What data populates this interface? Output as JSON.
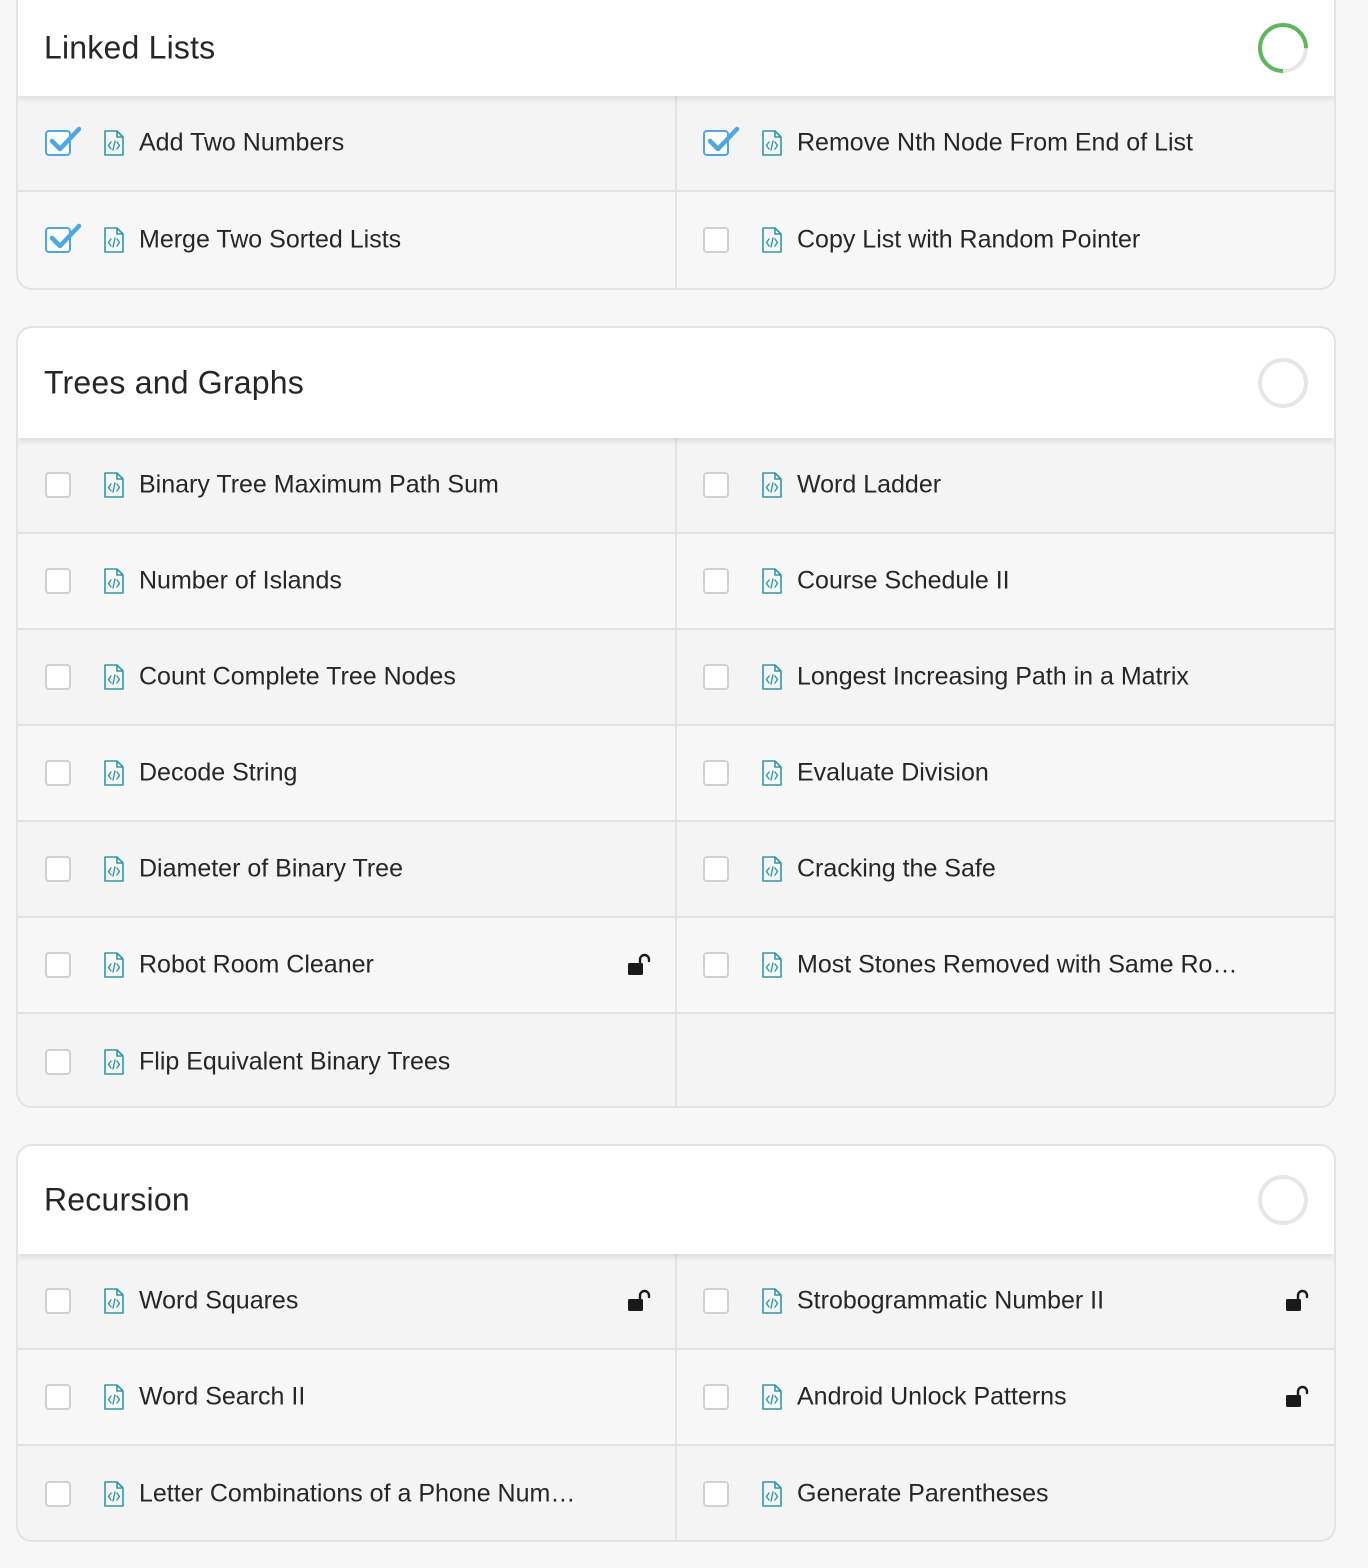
{
  "colors": {
    "accent_blue": "#4aa7e8",
    "progress_green": "#5cb85c",
    "ring_gray": "#e6e6e6",
    "icon_teal": "#2e9aa3",
    "text": "#262626"
  },
  "sections": [
    {
      "title": "Linked Lists",
      "progress": 0.75,
      "items": [
        {
          "label": "Add Two Numbers",
          "checked": true,
          "locked": false
        },
        {
          "label": "Remove Nth Node From End of List",
          "checked": true,
          "locked": false
        },
        {
          "label": "Merge Two Sorted Lists",
          "checked": true,
          "locked": false
        },
        {
          "label": "Copy List with Random Pointer",
          "checked": false,
          "locked": false
        }
      ]
    },
    {
      "title": "Trees and Graphs",
      "progress": 0,
      "items": [
        {
          "label": "Binary Tree Maximum Path Sum",
          "checked": false,
          "locked": false
        },
        {
          "label": "Word Ladder",
          "checked": false,
          "locked": false
        },
        {
          "label": "Number of Islands",
          "checked": false,
          "locked": false
        },
        {
          "label": "Course Schedule II",
          "checked": false,
          "locked": false
        },
        {
          "label": "Count Complete Tree Nodes",
          "checked": false,
          "locked": false
        },
        {
          "label": "Longest Increasing Path in a Matrix",
          "checked": false,
          "locked": false
        },
        {
          "label": "Decode String",
          "checked": false,
          "locked": false
        },
        {
          "label": "Evaluate Division",
          "checked": false,
          "locked": false
        },
        {
          "label": "Diameter of Binary Tree",
          "checked": false,
          "locked": false
        },
        {
          "label": "Cracking the Safe",
          "checked": false,
          "locked": false
        },
        {
          "label": "Robot Room Cleaner",
          "checked": false,
          "locked": true
        },
        {
          "label": "Most Stones Removed with Same Ro…",
          "checked": false,
          "locked": false
        },
        {
          "label": "Flip Equivalent Binary Trees",
          "checked": false,
          "locked": false
        }
      ]
    },
    {
      "title": "Recursion",
      "progress": 0,
      "items": [
        {
          "label": "Word Squares",
          "checked": false,
          "locked": true
        },
        {
          "label": "Strobogrammatic Number II",
          "checked": false,
          "locked": true
        },
        {
          "label": "Word Search II",
          "checked": false,
          "locked": false
        },
        {
          "label": "Android Unlock Patterns",
          "checked": false,
          "locked": true
        },
        {
          "label": "Letter Combinations of a Phone Num…",
          "checked": false,
          "locked": false
        },
        {
          "label": "Generate Parentheses",
          "checked": false,
          "locked": false
        }
      ]
    }
  ]
}
